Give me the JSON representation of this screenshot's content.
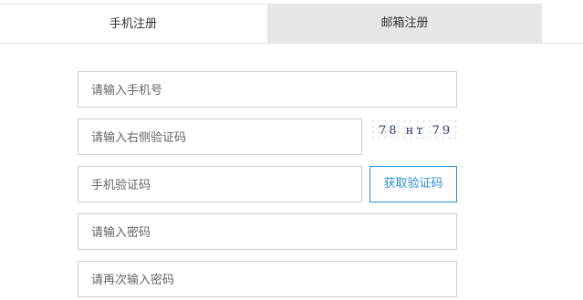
{
  "tabs": [
    {
      "label": "手机注册",
      "active": true
    },
    {
      "label": "邮箱注册",
      "active": false
    }
  ],
  "form": {
    "phone_placeholder": "请输入手机号",
    "captcha_placeholder": "请输入右侧验证码",
    "captcha_text": "78 нт 79",
    "sms_code_placeholder": "手机验证码",
    "get_code_button": "获取验证码",
    "password_placeholder": "请输入密码",
    "confirm_password_placeholder": "请再次输入密码"
  },
  "colors": {
    "accent": "#2f8fd8",
    "inactive_tab_bg": "#e7e7e7",
    "field_border": "#cfcfcf"
  }
}
